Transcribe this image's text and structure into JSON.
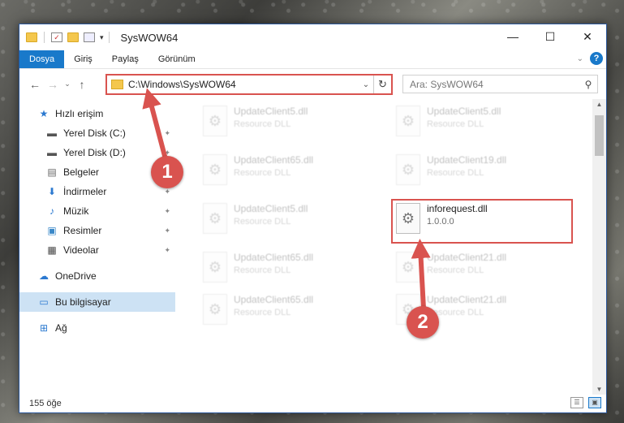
{
  "window": {
    "title": "SysWOW64",
    "controls": {
      "minimize": "—",
      "maximize": "☐",
      "close": "✕"
    }
  },
  "ribbon": {
    "tabs": [
      {
        "label": "Dosya",
        "active": true
      },
      {
        "label": "Giriş"
      },
      {
        "label": "Paylaş"
      },
      {
        "label": "Görünüm"
      }
    ],
    "help": "?"
  },
  "navigation": {
    "back": "←",
    "forward": "→",
    "recent": "⌄",
    "up": "↑",
    "address": "C:\\Windows\\SysWOW64",
    "refresh": "↻",
    "search_placeholder": "Ara: SysWOW64",
    "search_icon": "⚲"
  },
  "sidebar": {
    "items": [
      {
        "label": "Hızlı erişim",
        "icon": "star-icon",
        "glyph": "★",
        "color": "#2b79d0"
      },
      {
        "label": "Yerel Disk (C:)",
        "icon": "drive-icon",
        "glyph": "▬",
        "color": "#555",
        "pinned": true
      },
      {
        "label": "Yerel Disk (D:)",
        "icon": "drive-icon",
        "glyph": "▬",
        "color": "#555",
        "pinned": true
      },
      {
        "label": "Belgeler",
        "icon": "documents-icon",
        "glyph": "▤",
        "color": "#666",
        "pinned": true
      },
      {
        "label": "İndirmeler",
        "icon": "download-icon",
        "glyph": "⬇",
        "color": "#2b79d0",
        "pinned": true
      },
      {
        "label": "Müzik",
        "icon": "music-icon",
        "glyph": "♪",
        "color": "#2b79d0",
        "pinned": true
      },
      {
        "label": "Resimler",
        "icon": "pictures-icon",
        "glyph": "▣",
        "color": "#3a88c8",
        "pinned": true
      },
      {
        "label": "Videolar",
        "icon": "videos-icon",
        "glyph": "▦",
        "color": "#444",
        "pinned": true
      },
      {
        "label": "OneDrive",
        "icon": "cloud-icon",
        "glyph": "☁",
        "color": "#2b79d0"
      },
      {
        "label": "Bu bilgisayar",
        "icon": "computer-icon",
        "glyph": "▭",
        "color": "#2b79d0",
        "selected": true
      },
      {
        "label": "Ağ",
        "icon": "network-icon",
        "glyph": "⊞",
        "color": "#2b79d0"
      }
    ],
    "pin_glyph": "📌"
  },
  "files": [
    {
      "name": "UpdateClient5.dll",
      "type": "Resource DLL"
    },
    {
      "name": "UpdateClient5.dll",
      "type": "Resource DLL"
    },
    {
      "name": "UpdateClient65.dll",
      "type": "Resource DLL"
    },
    {
      "name": "UpdateClient19.dll",
      "type": "Resource DLL"
    },
    {
      "name": "UpdateClient5.dll",
      "type": "Resource DLL"
    },
    {
      "name": "inforequest.dll",
      "type": "1.0.0.0",
      "highlighted": true
    },
    {
      "name": "UpdateClient65.dll",
      "type": "Resource DLL"
    },
    {
      "name": "UpdateClient21.dll",
      "type": "Resource DLL"
    },
    {
      "name": "UpdateClient65.dll",
      "type": "Resource DLL"
    },
    {
      "name": "UpdateClient21.dll",
      "type": "Resource DLL"
    }
  ],
  "status": {
    "count": "155 öğe"
  },
  "annotations": {
    "badge_1": "1",
    "badge_2": "2",
    "color": "#d9534f"
  }
}
